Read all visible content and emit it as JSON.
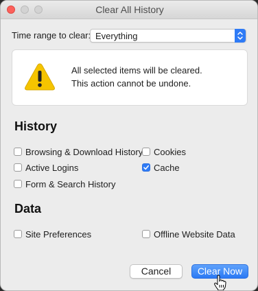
{
  "window": {
    "title": "Clear All History"
  },
  "time_range": {
    "label": "Time range to clear:",
    "selected": "Everything"
  },
  "warning": {
    "icon": "warning-triangle-icon",
    "line1": "All selected items will be cleared.",
    "line2": "This action cannot be undone."
  },
  "history": {
    "heading": "History",
    "items": [
      {
        "label": "Browsing & Download History",
        "checked": false
      },
      {
        "label": "Cookies",
        "checked": false
      },
      {
        "label": "Active Logins",
        "checked": false
      },
      {
        "label": "Cache",
        "checked": true
      },
      {
        "label": "Form & Search History",
        "checked": false
      }
    ]
  },
  "data": {
    "heading": "Data",
    "items": [
      {
        "label": "Site Preferences",
        "checked": false
      },
      {
        "label": "Offline Website Data",
        "checked": false
      }
    ]
  },
  "buttons": {
    "cancel": "Cancel",
    "clear_now": "Clear Now"
  },
  "colors": {
    "accent": "#2f7bf6",
    "close_button": "#fc605b",
    "warning_yellow": "#f5c400"
  }
}
